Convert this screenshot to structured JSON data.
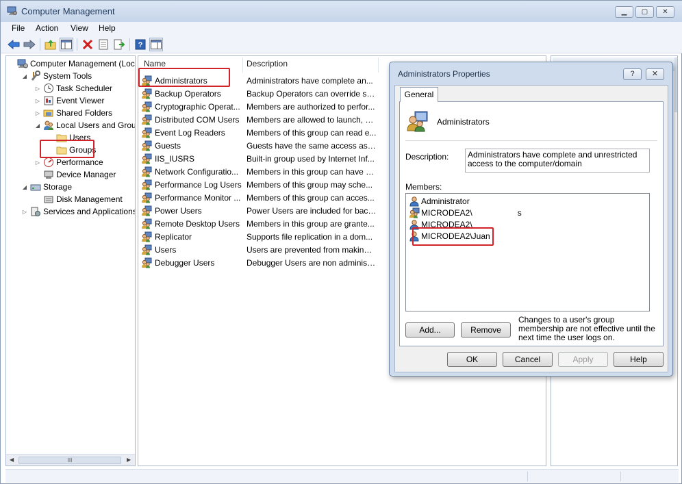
{
  "window": {
    "title": "Computer Management",
    "minimize_icon": "minimize-icon",
    "maximize_icon": "maximize-icon",
    "close_icon": "close-icon"
  },
  "menu": [
    "File",
    "Action",
    "View",
    "Help"
  ],
  "toolbar": {
    "icons": [
      "back-arrow-icon",
      "forward-arrow-icon",
      "up-folder-icon",
      "show-hide-tree-icon",
      "delete-icon",
      "properties-icon",
      "export-list-icon",
      "help-icon",
      "show-hide-action-pane-icon"
    ]
  },
  "tree": [
    {
      "label": "Computer Management (Local",
      "depth": 0,
      "expander": "",
      "icon": "computer-icon"
    },
    {
      "label": "System Tools",
      "depth": 1,
      "expander": "◢",
      "icon": "tools-icon"
    },
    {
      "label": "Task Scheduler",
      "depth": 2,
      "expander": "▷",
      "icon": "clock-icon"
    },
    {
      "label": "Event Viewer",
      "depth": 2,
      "expander": "▷",
      "icon": "event-viewer-icon"
    },
    {
      "label": "Shared Folders",
      "depth": 2,
      "expander": "▷",
      "icon": "shared-folder-icon"
    },
    {
      "label": "Local Users and Groups",
      "depth": 2,
      "expander": "◢",
      "icon": "users-groups-icon"
    },
    {
      "label": "Users",
      "depth": 3,
      "expander": "",
      "icon": "folder-icon"
    },
    {
      "label": "Groups",
      "depth": 3,
      "expander": "",
      "icon": "folder-icon"
    },
    {
      "label": "Performance",
      "depth": 2,
      "expander": "▷",
      "icon": "performance-icon"
    },
    {
      "label": "Device Manager",
      "depth": 2,
      "expander": "",
      "icon": "device-manager-icon"
    },
    {
      "label": "Storage",
      "depth": 1,
      "expander": "◢",
      "icon": "storage-icon"
    },
    {
      "label": "Disk Management",
      "depth": 2,
      "expander": "",
      "icon": "disk-icon"
    },
    {
      "label": "Services and Applications",
      "depth": 1,
      "expander": "▷",
      "icon": "services-icon"
    }
  ],
  "tree_scroll": {
    "left_arrow": "◀",
    "thumb": "III",
    "right_arrow": "▶"
  },
  "list": {
    "columns": [
      "Name",
      "Description"
    ],
    "rows": [
      {
        "name": "Administrators",
        "description": "Administrators have complete an..."
      },
      {
        "name": "Backup Operators",
        "description": "Backup Operators can override se..."
      },
      {
        "name": "Cryptographic Operat...",
        "description": "Members are authorized to perfor..."
      },
      {
        "name": "Distributed COM Users",
        "description": "Members are allowed to launch, a..."
      },
      {
        "name": "Event Log Readers",
        "description": "Members of this group can read e..."
      },
      {
        "name": "Guests",
        "description": "Guests have the same access as m..."
      },
      {
        "name": "IIS_IUSRS",
        "description": "Built-in group used by Internet Inf..."
      },
      {
        "name": "Network Configuratio...",
        "description": "Members in this group can have s..."
      },
      {
        "name": "Performance Log Users",
        "description": "Members of this group may sche..."
      },
      {
        "name": "Performance Monitor ...",
        "description": "Members of this group can acces..."
      },
      {
        "name": "Power Users",
        "description": "Power Users are included for back..."
      },
      {
        "name": "Remote Desktop Users",
        "description": "Members in this group are grante..."
      },
      {
        "name": "Replicator",
        "description": "Supports file replication in a dom..."
      },
      {
        "name": "Users",
        "description": "Users are prevented from making ..."
      },
      {
        "name": "Debugger Users",
        "description": "Debugger Users are non administr..."
      }
    ]
  },
  "dialog": {
    "title": "Administrators Properties",
    "help_icon": "?",
    "close_icon": "close-icon",
    "tab": "General",
    "group_name": "Administrators",
    "description_label": "Description:",
    "description_value": "Administrators have complete and unrestricted access to the computer/domain",
    "members_label": "Members:",
    "members": [
      {
        "name": "Administrator",
        "icon": "user-icon"
      },
      {
        "name": "MICRODEA2\\",
        "suffix": "s",
        "icon": "group-icon"
      },
      {
        "name": "MICRODEA2\\",
        "suffix": "",
        "icon": "user-icon"
      },
      {
        "name": "MICRODEA2\\Juan",
        "suffix": "",
        "icon": "user-icon"
      }
    ],
    "add_button": "Add...",
    "remove_button": "Remove",
    "note": "Changes to a user's group membership are not effective until the next time the user logs on.",
    "ok_button": "OK",
    "cancel_button": "Cancel",
    "apply_button": "Apply",
    "help_button": "Help"
  },
  "colors": {
    "highlight_red": "#d2232a",
    "window_frame": "#c6d5ea",
    "dialog_frame": "#cfdcee"
  }
}
